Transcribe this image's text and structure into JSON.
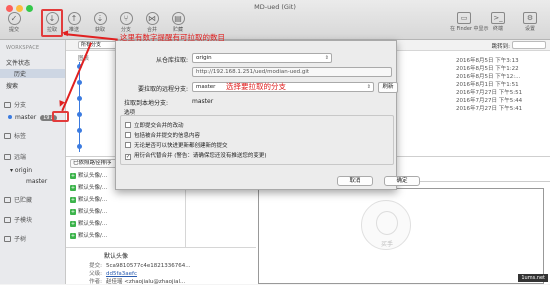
{
  "window": {
    "title": "MD-ued (Git)"
  },
  "toolbar": {
    "items": [
      {
        "label": "提交",
        "icon": "commit-icon"
      },
      {
        "label": "拉取",
        "icon": "pull-icon"
      },
      {
        "label": "推送",
        "icon": "push-icon"
      },
      {
        "label": "获取",
        "icon": "fetch-icon"
      },
      {
        "label": "分支",
        "icon": "branch-icon"
      },
      {
        "label": "合并",
        "icon": "merge-icon"
      },
      {
        "label": "贮藏",
        "icon": "stash-icon"
      }
    ],
    "right_items": [
      {
        "label": "在 Finder 中显示",
        "icon": "finder-icon"
      },
      {
        "label": "终端",
        "icon": "terminal-icon"
      },
      {
        "label": "设置",
        "icon": "settings-icon"
      }
    ]
  },
  "sidebar": {
    "workspace_header": "WORKSPACE",
    "workspace_items": [
      "文件状态",
      "历史",
      "搜索"
    ],
    "branches_section": "分支",
    "current_branch": "master",
    "pull_badge": "19↓",
    "tags_section": "标签",
    "remotes_section": "远端",
    "remote_name": "origin",
    "remote_branch": "master",
    "stashes_section": "已贮藏",
    "submodules_section": "子模块",
    "subtrees_section": "子树"
  },
  "main": {
    "filter_select": "所有分支",
    "jump_label": "跳转到:",
    "graph_header": "图表",
    "dates": [
      "2016年8月5日 下午3:13",
      "2016年8月5日 下午1:22",
      "2016年8月5日 下午12:...",
      "2016年8月1日 下午1:51",
      "2016年7月27日 下午5:51",
      "2016年7月27日 下午5:44",
      "2016年7月27日 下午5:41"
    ],
    "file_tab": "已依照路径排序",
    "files": [
      "默认头像/...",
      "默认头像/...",
      "默认头像/...",
      "默认头像/...",
      "默认头像/...",
      "默认头像/..."
    ],
    "commit": {
      "title": "默认头像",
      "rows": [
        {
          "key": "提交:",
          "value": "5ca9810577c4e1821336764..."
        },
        {
          "key": "父级:",
          "value": "dd5fa3aefc"
        },
        {
          "key": "作者:",
          "value": "赵佳瑶 <zhaojialu@zhaojial..."
        },
        {
          "key": "日期:",
          "value": ""
        }
      ]
    },
    "watermark": "买手",
    "corner_watermark": "1ums.net"
  },
  "dialog": {
    "from_repo_label": "从仓库拉取:",
    "from_repo_value": "origin",
    "repo_url": "http://192.168.1.251/ued/modian-ued.git",
    "remote_branch_label": "要拉取的远程分支:",
    "remote_branch_value": "master",
    "refresh_label": "刷新",
    "local_branch_label": "拉取到本地分支:",
    "local_branch_value": "master",
    "options_label": "选项",
    "options": [
      {
        "label": "立即提交合并的改动",
        "checked": false
      },
      {
        "label": "包括被合并提交的信息内容",
        "checked": false
      },
      {
        "label": "无论是否可以快进更新都创建新的提交",
        "checked": false
      },
      {
        "label": "用衍合代替合并 (警告：请确保您还没有推送您的变更)",
        "checked": true
      }
    ],
    "cancel_label": "取消",
    "ok_label": "确定"
  },
  "annotations": {
    "pull_note": "这里有数字提醒有可拉取的数目",
    "branch_note": "选择要拉取的分支",
    "color": "#e02020"
  }
}
